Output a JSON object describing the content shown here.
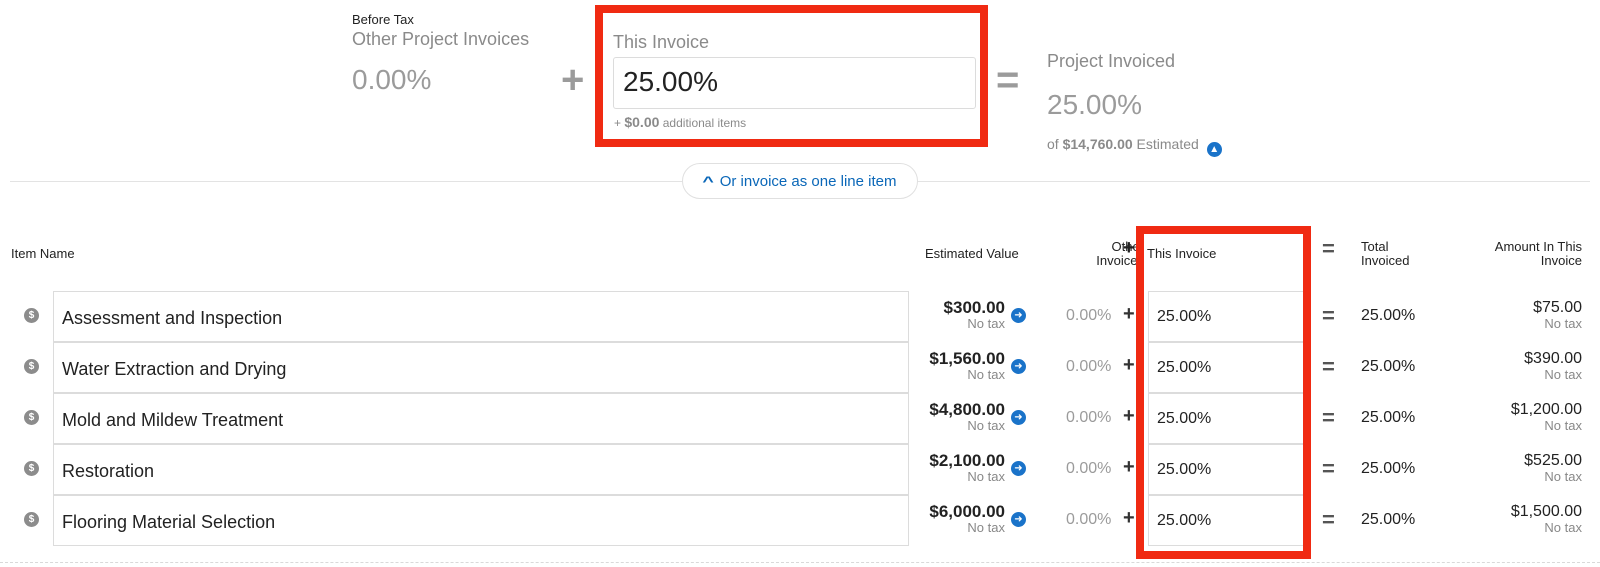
{
  "summary": {
    "before_tax_label": "Before Tax",
    "other_invoices_label": "Other Project Invoices",
    "other_invoices_value": "0.00%",
    "plus_symbol": "+",
    "this_invoice_label": "This Invoice",
    "this_invoice_value": "25.00%",
    "additional_prefix": "+",
    "additional_amount": "$0.00",
    "additional_suffix": "additional items",
    "equals_symbol": "=",
    "project_invoiced_label": "Project Invoiced",
    "project_invoiced_value": "25.00%",
    "of_prefix": "of",
    "estimated_amount": "$14,760.00",
    "estimated_suffix": "Estimated",
    "info_icon": "arrow-up-circle-icon"
  },
  "line_item_button": {
    "label": "Or invoice as one line item",
    "icon": "chevron-up-icon"
  },
  "table": {
    "headers": {
      "item_name": "Item Name",
      "estimated_value": "Estimated Value",
      "other_invoices_line1": "Other",
      "other_invoices_line2": "Invoices",
      "plus": "+",
      "this_invoice": "This Invoice",
      "equals": "=",
      "total_line1": "Total",
      "total_line2": "Invoiced",
      "amount_line1": "Amount In This",
      "amount_line2": "Invoice"
    },
    "rows": [
      {
        "name": "Assessment and Inspection",
        "estimated": "$300.00",
        "tax": "No tax",
        "other": "0.00%",
        "plus": "+",
        "this_invoice": "25.00%",
        "equals": "=",
        "total": "25.00%",
        "amount": "$75.00",
        "amount_tax": "No tax"
      },
      {
        "name": "Water Extraction and Drying",
        "estimated": "$1,560.00",
        "tax": "No tax",
        "other": "0.00%",
        "plus": "+",
        "this_invoice": "25.00%",
        "equals": "=",
        "total": "25.00%",
        "amount": "$390.00",
        "amount_tax": "No tax"
      },
      {
        "name": "Mold and Mildew Treatment",
        "estimated": "$4,800.00",
        "tax": "No tax",
        "other": "0.00%",
        "plus": "+",
        "this_invoice": "25.00%",
        "equals": "=",
        "total": "25.00%",
        "amount": "$1,200.00",
        "amount_tax": "No tax"
      },
      {
        "name": "Restoration",
        "estimated": "$2,100.00",
        "tax": "No tax",
        "other": "0.00%",
        "plus": "+",
        "this_invoice": "25.00%",
        "equals": "=",
        "total": "25.00%",
        "amount": "$525.00",
        "amount_tax": "No tax"
      },
      {
        "name": "Flooring Material Selection",
        "estimated": "$6,000.00",
        "tax": "No tax",
        "other": "0.00%",
        "plus": "+",
        "this_invoice": "25.00%",
        "equals": "=",
        "total": "25.00%",
        "amount": "$1,500.00",
        "amount_tax": "No tax"
      }
    ]
  },
  "colors": {
    "highlight": "#f02a12",
    "link_blue": "#0a67b8",
    "icon_blue": "#1a73c9",
    "muted_gray": "#9b9b9b"
  }
}
